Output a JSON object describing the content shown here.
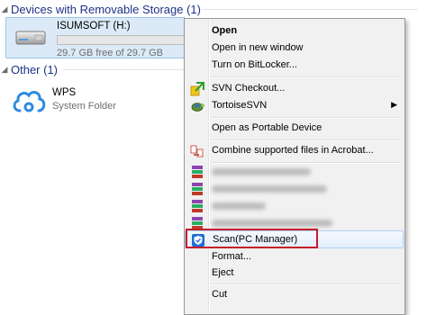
{
  "groups": {
    "removable": {
      "title": "Devices with Removable Storage (1)"
    },
    "other": {
      "title": "Other (1)"
    }
  },
  "drive": {
    "name": "ISUMSOFT (H:)",
    "free_text": "29.7 GB free of 29.7 GB",
    "used_fraction": 0.0
  },
  "wps": {
    "name": "WPS",
    "type": "System Folder"
  },
  "context_menu": {
    "items": {
      "open": "Open",
      "open_new_window": "Open in new window",
      "bitlocker": "Turn on BitLocker...",
      "svn_checkout": "SVN Checkout...",
      "tortoisesvn": "TortoiseSVN",
      "portable_device": "Open as Portable Device",
      "combine_acrobat": "Combine supported files in Acrobat...",
      "scan": "Scan(PC Manager)",
      "format": "Format...",
      "eject": "Eject",
      "cut": "Cut"
    },
    "submenu_arrow": "▶"
  },
  "colors": {
    "highlight_border": "#c81c28",
    "group_header": "#1e3287",
    "selection_bg": "#dceaf8"
  }
}
